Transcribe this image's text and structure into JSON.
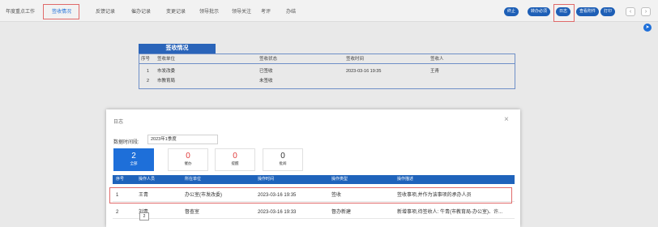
{
  "topbar": {
    "tabs": [
      "年度重点工作",
      "签收情况",
      "反馈记录",
      "催办记录",
      "变更记录",
      "领导批示",
      "领导关注",
      "考评",
      "办结"
    ],
    "active_tab": 1,
    "buttons": [
      "终止",
      "转办必须",
      "日志",
      "查看附件",
      "打印"
    ],
    "prev_icon": "chevron-left-icon",
    "next_icon": "chevron-right-icon",
    "accent_color": "#1e5fb6",
    "highlight_color": "#e06a6a"
  },
  "fab": {
    "icon": "send-icon",
    "glyph": "➤"
  },
  "sign": {
    "title": "签收情况",
    "headers": [
      "序号",
      "签收单位",
      "签收状态",
      "签收时间",
      "签收人"
    ],
    "rows": [
      [
        "1",
        "市发改委",
        "已签收",
        "2023-03-16 19:35",
        "王青"
      ],
      [
        "2",
        "市教育局",
        "未签收",
        "",
        ""
      ]
    ]
  },
  "modal": {
    "title": "日志",
    "close_glyph": "×",
    "period_label": "数据时间段:",
    "period_value": "2023年1季度",
    "stats": [
      {
        "num": "2",
        "label": "全部"
      },
      {
        "num": "0",
        "label": "催办"
      },
      {
        "num": "0",
        "label": "提醒"
      },
      {
        "num": "0",
        "label": "批阅"
      }
    ],
    "headers": [
      "序号",
      "操作人员",
      "所在单位",
      "操作时间",
      "操作类型",
      "操作描述"
    ],
    "rows": [
      [
        "1",
        "王青",
        "办公室(市发改委)",
        "2023-03-16 19:35",
        "签收",
        "签收事项,并作为该事项的承办人员"
      ],
      [
        "2",
        "刘青",
        "督查室",
        "2023-03-16 19:33",
        "督办新建",
        "新增事项,待签收人: 牛青(市教育局-办公室)、许..."
      ]
    ],
    "mini_button": "2"
  }
}
